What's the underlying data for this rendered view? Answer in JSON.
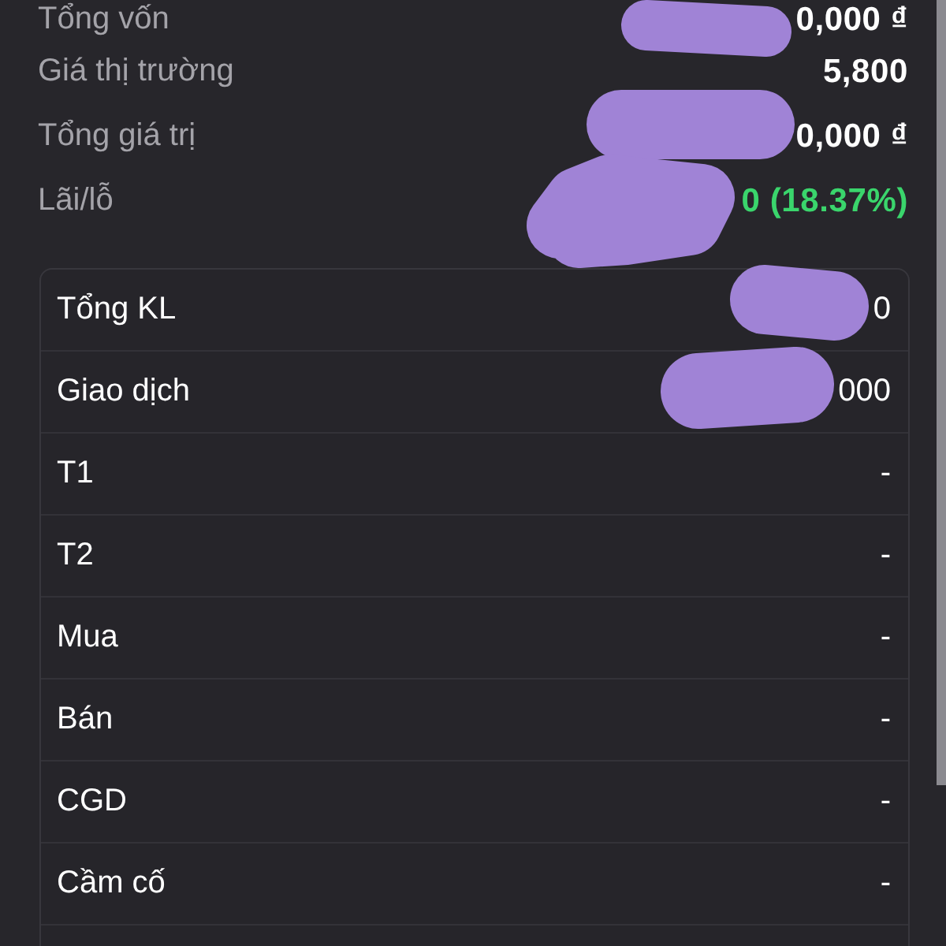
{
  "summary": [
    {
      "label": "Tổng vốn",
      "value": "0,000 ₫",
      "kind": "plain",
      "redacted": true
    },
    {
      "label": "Giá thị trường",
      "value": "5,800",
      "kind": "plain",
      "redacted": false
    },
    {
      "label": "Tổng giá trị",
      "value": "0,000 ₫",
      "kind": "plain",
      "redacted": true
    },
    {
      "label": "Lãi/lỗ",
      "value": "0 (18.37%)",
      "kind": "gain",
      "redacted": true
    }
  ],
  "details": {
    "rows": [
      {
        "label": "Tổng KL",
        "value": "0",
        "redacted": true
      },
      {
        "label": "Giao dịch",
        "value": "000",
        "redacted": true
      },
      {
        "label": "T1",
        "value": "-",
        "redacted": false
      },
      {
        "label": "T2",
        "value": "-",
        "redacted": false
      },
      {
        "label": "Mua",
        "value": "-",
        "redacted": false
      },
      {
        "label": "Bán",
        "value": "-",
        "redacted": false
      },
      {
        "label": "CGD",
        "value": "-",
        "redacted": false
      },
      {
        "label": "Cầm cố",
        "value": "-",
        "redacted": false
      }
    ]
  }
}
